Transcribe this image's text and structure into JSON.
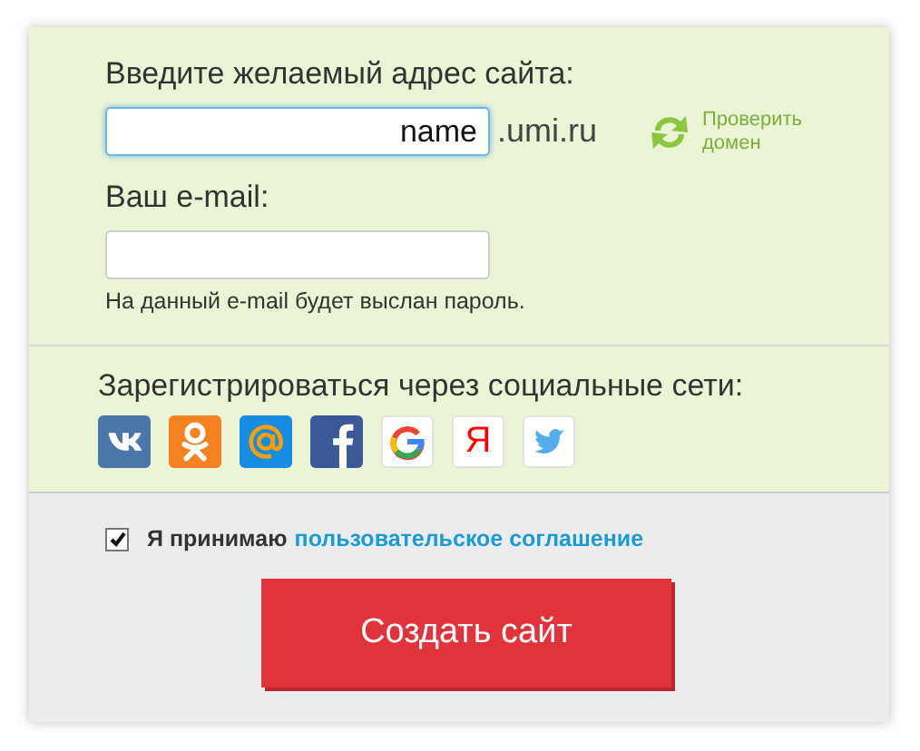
{
  "site_label": "Введите желаемый адрес сайта:",
  "site_field": {
    "value": "name"
  },
  "domain_suffix": ".umi.ru",
  "check_link": {
    "label": "Проверить домен"
  },
  "email_label": "Ваш e-mail:",
  "email_hint": "На данный e-mail будет выслан пароль.",
  "social_label": "Зарегистрироваться через социальные сети:",
  "social_buttons": [
    {
      "kind": "vk"
    },
    {
      "kind": "ok"
    },
    {
      "kind": "mail"
    },
    {
      "kind": "facebook"
    },
    {
      "kind": "google"
    },
    {
      "kind": "yandex",
      "glyph": "Я"
    },
    {
      "kind": "twitter"
    }
  ],
  "agreement": {
    "checked": true,
    "text": "Я принимаю",
    "link": "пользовательское соглашение"
  },
  "submit_button": "Создать сайт"
}
